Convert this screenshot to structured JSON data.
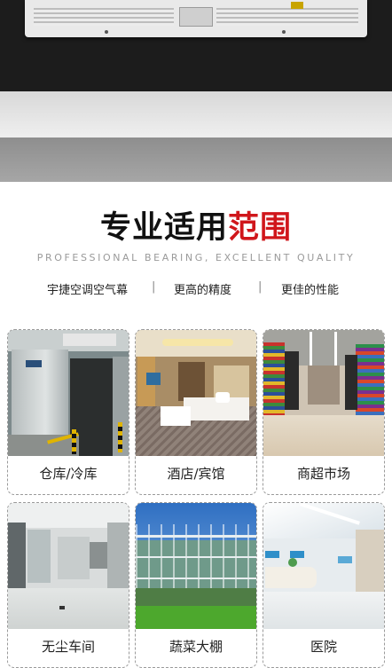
{
  "heading": {
    "black": "专业适用",
    "red": "范围"
  },
  "subtitle": "PROFESSIONAL BEARING, EXCELLENT QUALITY",
  "features": [
    "宇捷空调空气幕",
    "更高的精度",
    "更佳的性能"
  ],
  "separator": "|",
  "cards": [
    {
      "label": "仓库/冷库",
      "icon": "cold-storage-photo"
    },
    {
      "label": "酒店/宾馆",
      "icon": "hotel-room-photo"
    },
    {
      "label": "商超市场",
      "icon": "supermarket-photo"
    },
    {
      "label": "无尘车间",
      "icon": "clean-room-photo"
    },
    {
      "label": "蔬菜大棚",
      "icon": "greenhouse-photo"
    },
    {
      "label": "医院",
      "icon": "hospital-photo"
    }
  ],
  "colors": {
    "accent_red": "#d0161b",
    "text": "#222222",
    "subtitle": "#9a9a9a"
  }
}
